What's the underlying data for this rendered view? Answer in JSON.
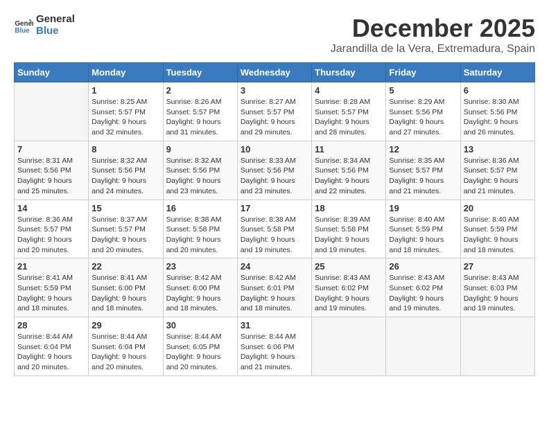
{
  "logo": {
    "line1": "General",
    "line2": "Blue"
  },
  "title": "December 2025",
  "location": "Jarandilla de la Vera, Extremadura, Spain",
  "weekdays": [
    "Sunday",
    "Monday",
    "Tuesday",
    "Wednesday",
    "Thursday",
    "Friday",
    "Saturday"
  ],
  "weeks": [
    [
      {
        "day": "",
        "info": ""
      },
      {
        "day": "1",
        "info": "Sunrise: 8:25 AM\nSunset: 5:57 PM\nDaylight: 9 hours\nand 32 minutes."
      },
      {
        "day": "2",
        "info": "Sunrise: 8:26 AM\nSunset: 5:57 PM\nDaylight: 9 hours\nand 31 minutes."
      },
      {
        "day": "3",
        "info": "Sunrise: 8:27 AM\nSunset: 5:57 PM\nDaylight: 9 hours\nand 29 minutes."
      },
      {
        "day": "4",
        "info": "Sunrise: 8:28 AM\nSunset: 5:57 PM\nDaylight: 9 hours\nand 28 minutes."
      },
      {
        "day": "5",
        "info": "Sunrise: 8:29 AM\nSunset: 5:56 PM\nDaylight: 9 hours\nand 27 minutes."
      },
      {
        "day": "6",
        "info": "Sunrise: 8:30 AM\nSunset: 5:56 PM\nDaylight: 9 hours\nand 26 minutes."
      }
    ],
    [
      {
        "day": "7",
        "info": "Sunrise: 8:31 AM\nSunset: 5:56 PM\nDaylight: 9 hours\nand 25 minutes."
      },
      {
        "day": "8",
        "info": "Sunrise: 8:32 AM\nSunset: 5:56 PM\nDaylight: 9 hours\nand 24 minutes."
      },
      {
        "day": "9",
        "info": "Sunrise: 8:32 AM\nSunset: 5:56 PM\nDaylight: 9 hours\nand 23 minutes."
      },
      {
        "day": "10",
        "info": "Sunrise: 8:33 AM\nSunset: 5:56 PM\nDaylight: 9 hours\nand 23 minutes."
      },
      {
        "day": "11",
        "info": "Sunrise: 8:34 AM\nSunset: 5:56 PM\nDaylight: 9 hours\nand 22 minutes."
      },
      {
        "day": "12",
        "info": "Sunrise: 8:35 AM\nSunset: 5:57 PM\nDaylight: 9 hours\nand 21 minutes."
      },
      {
        "day": "13",
        "info": "Sunrise: 8:36 AM\nSunset: 5:57 PM\nDaylight: 9 hours\nand 21 minutes."
      }
    ],
    [
      {
        "day": "14",
        "info": "Sunrise: 8:36 AM\nSunset: 5:57 PM\nDaylight: 9 hours\nand 20 minutes."
      },
      {
        "day": "15",
        "info": "Sunrise: 8:37 AM\nSunset: 5:57 PM\nDaylight: 9 hours\nand 20 minutes."
      },
      {
        "day": "16",
        "info": "Sunrise: 8:38 AM\nSunset: 5:58 PM\nDaylight: 9 hours\nand 20 minutes."
      },
      {
        "day": "17",
        "info": "Sunrise: 8:38 AM\nSunset: 5:58 PM\nDaylight: 9 hours\nand 19 minutes."
      },
      {
        "day": "18",
        "info": "Sunrise: 8:39 AM\nSunset: 5:58 PM\nDaylight: 9 hours\nand 19 minutes."
      },
      {
        "day": "19",
        "info": "Sunrise: 8:40 AM\nSunset: 5:59 PM\nDaylight: 9 hours\nand 18 minutes."
      },
      {
        "day": "20",
        "info": "Sunrise: 8:40 AM\nSunset: 5:59 PM\nDaylight: 9 hours\nand 18 minutes."
      }
    ],
    [
      {
        "day": "21",
        "info": "Sunrise: 8:41 AM\nSunset: 5:59 PM\nDaylight: 9 hours\nand 18 minutes."
      },
      {
        "day": "22",
        "info": "Sunrise: 8:41 AM\nSunset: 6:00 PM\nDaylight: 9 hours\nand 18 minutes."
      },
      {
        "day": "23",
        "info": "Sunrise: 8:42 AM\nSunset: 6:00 PM\nDaylight: 9 hours\nand 18 minutes."
      },
      {
        "day": "24",
        "info": "Sunrise: 8:42 AM\nSunset: 6:01 PM\nDaylight: 9 hours\nand 18 minutes."
      },
      {
        "day": "25",
        "info": "Sunrise: 8:43 AM\nSunset: 6:02 PM\nDaylight: 9 hours\nand 19 minutes."
      },
      {
        "day": "26",
        "info": "Sunrise: 8:43 AM\nSunset: 6:02 PM\nDaylight: 9 hours\nand 19 minutes."
      },
      {
        "day": "27",
        "info": "Sunrise: 8:43 AM\nSunset: 6:03 PM\nDaylight: 9 hours\nand 19 minutes."
      }
    ],
    [
      {
        "day": "28",
        "info": "Sunrise: 8:44 AM\nSunset: 6:04 PM\nDaylight: 9 hours\nand 20 minutes."
      },
      {
        "day": "29",
        "info": "Sunrise: 8:44 AM\nSunset: 6:04 PM\nDaylight: 9 hours\nand 20 minutes."
      },
      {
        "day": "30",
        "info": "Sunrise: 8:44 AM\nSunset: 6:05 PM\nDaylight: 9 hours\nand 20 minutes."
      },
      {
        "day": "31",
        "info": "Sunrise: 8:44 AM\nSunset: 6:06 PM\nDaylight: 9 hours\nand 21 minutes."
      },
      {
        "day": "",
        "info": ""
      },
      {
        "day": "",
        "info": ""
      },
      {
        "day": "",
        "info": ""
      }
    ]
  ]
}
